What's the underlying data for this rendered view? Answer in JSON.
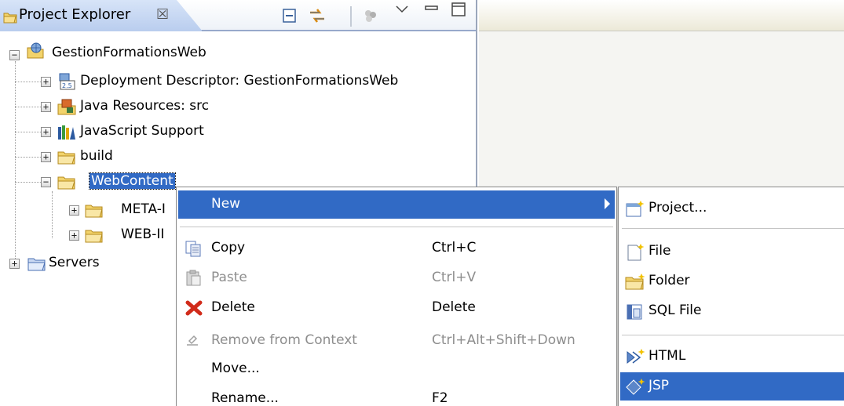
{
  "view": {
    "title": "Project Explorer",
    "close_glyph": "☒",
    "icon": "folder-open-icon",
    "toolbar": [
      "collapse-all-icon",
      "link-with-editor-icon",
      "filter-icon",
      "view-menu-icon",
      "minimize-icon",
      "maximize-icon"
    ]
  },
  "tree": {
    "project": "GestionFormationsWeb",
    "items": {
      "deployment": "Deployment Descriptor: GestionFormationsWeb",
      "java_resources": "Java Resources: src",
      "javascript": "JavaScript Support",
      "build": "build",
      "webcontent": "WebContent",
      "meta": "META-I",
      "webinf": "WEB-II",
      "servers": "Servers"
    },
    "deployment_badge": "2.5"
  },
  "context_menu": {
    "new": "New",
    "copy": "Copy",
    "copy_shortcut": "Ctrl+C",
    "paste": "Paste",
    "paste_shortcut": "Ctrl+V",
    "delete": "Delete",
    "delete_shortcut": "Delete",
    "remove": "Remove from Context",
    "remove_shortcut": "Ctrl+Alt+Shift+Down",
    "move": "Move...",
    "rename": "Rename...",
    "rename_shortcut": "F2"
  },
  "new_submenu": {
    "project": "Project...",
    "file": "File",
    "folder": "Folder",
    "sql_file": "SQL File",
    "html": "HTML",
    "jsp": "JSP"
  },
  "colors": {
    "selection": "#316ac5",
    "tab_gradient_top": "#d7e4f8",
    "tab_gradient_bottom": "#b9cdee"
  }
}
